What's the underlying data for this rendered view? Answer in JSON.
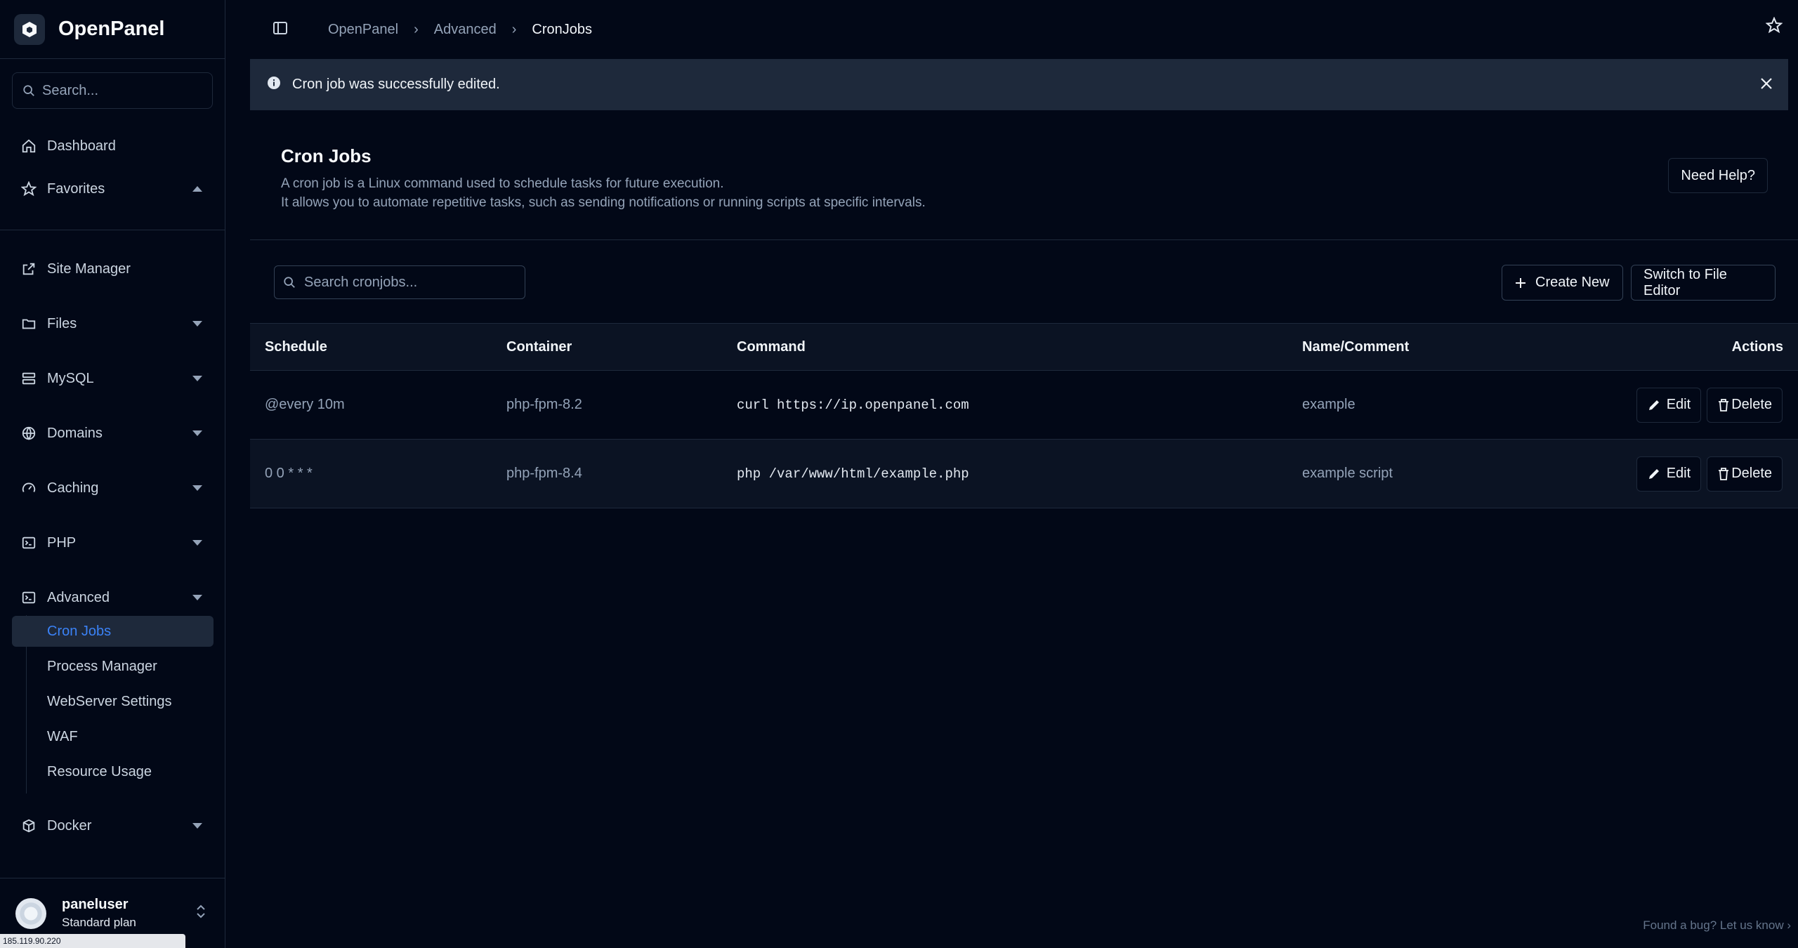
{
  "brand": {
    "name": "OpenPanel"
  },
  "sidebar": {
    "search_placeholder": "Search...",
    "items": [
      {
        "label": "Dashboard"
      },
      {
        "label": "Favorites"
      },
      {
        "label": "Site Manager"
      },
      {
        "label": "Files"
      },
      {
        "label": "MySQL"
      },
      {
        "label": "Domains"
      },
      {
        "label": "Caching"
      },
      {
        "label": "PHP"
      },
      {
        "label": "Advanced"
      },
      {
        "label": "Docker"
      }
    ],
    "advanced_sub": [
      {
        "label": "Cron Jobs"
      },
      {
        "label": "Process Manager"
      },
      {
        "label": "WebServer Settings"
      },
      {
        "label": "WAF"
      },
      {
        "label": "Resource Usage"
      }
    ],
    "user": {
      "name": "paneluser",
      "plan": "Standard plan"
    },
    "ip": "185.119.90.220"
  },
  "breadcrumb": [
    "OpenPanel",
    "Advanced",
    "CronJobs"
  ],
  "alert": {
    "message": "Cron job was successfully edited."
  },
  "page": {
    "title": "Cron Jobs",
    "desc_line1": "A cron job is a Linux command used to schedule tasks for future execution.",
    "desc_line2": "It allows you to automate repetitive tasks, such as sending notifications or running scripts at specific intervals.",
    "help_label": "Need Help?"
  },
  "toolbar": {
    "search_placeholder": "Search cronjobs...",
    "create_label": "Create New",
    "switch_label": "Switch to File Editor"
  },
  "table": {
    "headers": {
      "schedule": "Schedule",
      "container": "Container",
      "command": "Command",
      "name": "Name/Comment",
      "actions": "Actions"
    },
    "rows": [
      {
        "schedule": "@every 10m",
        "container": "php-fpm-8.2",
        "command": "curl https://ip.openpanel.com",
        "name": "example",
        "edit": "Edit",
        "delete": "Delete"
      },
      {
        "schedule": "0 0 * * *",
        "container": "php-fpm-8.4",
        "command": "php /var/www/html/example.php",
        "name": "example script",
        "edit": "Edit",
        "delete": "Delete"
      }
    ]
  },
  "footer": {
    "bug_text": "Found a bug? Let us know  ›"
  }
}
